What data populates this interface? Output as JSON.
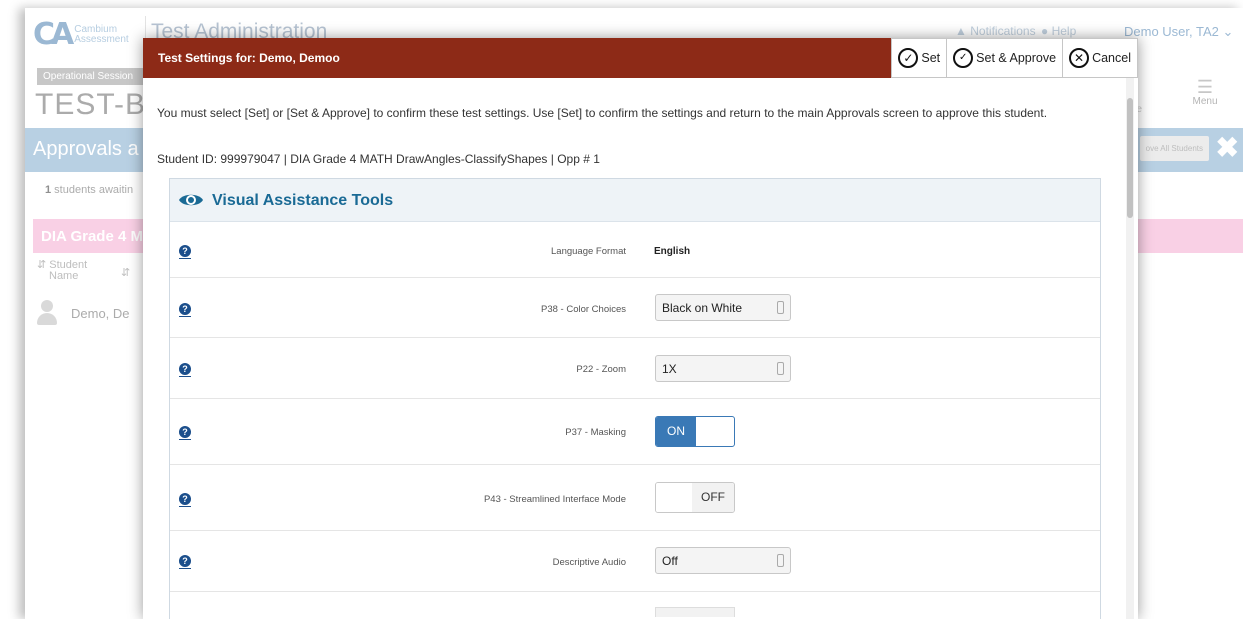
{
  "background": {
    "logo": {
      "mark": "CA",
      "line1": "Cambium",
      "line2": "Assessment"
    },
    "app_title": "Test Administration",
    "notifications_label": "Notifications",
    "help_label": "Help",
    "user_label": "Demo User, TA2",
    "session_label": "Operational Session",
    "session_id": "TEST-B",
    "menu_label": "Menu",
    "language_label": "ge",
    "page_title": "Approvals a",
    "approve_all_label": "ove All Students",
    "awaiting_count": "1",
    "awaiting_text": " students awaitin",
    "test_group_title": "DIA Grade 4 M",
    "column_student": "Student",
    "column_name": "Name",
    "student_row_name": "Demo, De"
  },
  "modal": {
    "title": "Test Settings for: Demo, Demoo",
    "actions": {
      "set_label": "Set",
      "set_approve_label": "Set & Approve",
      "cancel_label": "Cancel"
    },
    "instructions": "You must select [Set] or [Set & Approve] to confirm these test settings. Use [Set] to confirm the settings and return to the main Approvals screen to approve this student.",
    "student_info": "Student ID: 999979047 | DIA Grade 4 MATH DrawAngles-ClassifyShapes | Opp # 1",
    "panel_title": "Visual Assistance Tools",
    "settings": [
      {
        "label": "Language Format",
        "value": "English"
      },
      {
        "label": "P38 - Color Choices",
        "value": "Black on White"
      },
      {
        "label": "P22 - Zoom",
        "value": "1X"
      },
      {
        "label": "P37 - Masking",
        "value": "ON"
      },
      {
        "label": "P43 - Streamlined Interface Mode",
        "value": "OFF"
      },
      {
        "label": "Descriptive Audio",
        "value": "Off"
      }
    ]
  },
  "colors": {
    "modal_header": "#8d2a17",
    "accent_blue": "#1a6a95",
    "toggle_on": "#3a79b6",
    "pink_bar": "#f4a9cf",
    "blue_bar": "#7ea9cc"
  }
}
